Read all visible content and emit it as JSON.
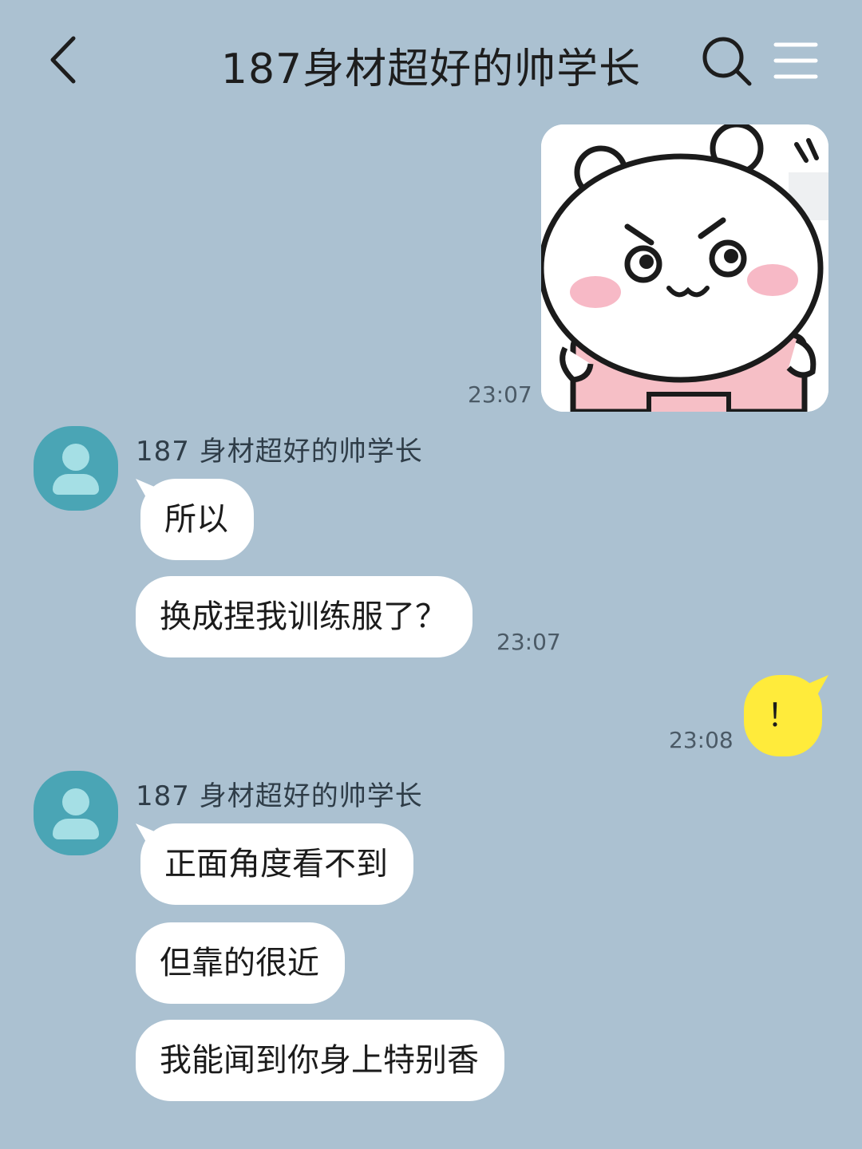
{
  "header": {
    "title": "187身材超好的帅学长",
    "back_icon": "chevron-left-icon",
    "search_icon": "search-icon",
    "menu_icon": "hamburger-menu-icon"
  },
  "messages": [
    {
      "type": "sticker",
      "from": "me",
      "time": "23:07",
      "sticker": "angry-white-bear-sticker"
    },
    {
      "from": "them",
      "sender": "187 身材超好的帅学长",
      "texts": [
        "所以",
        "换成捏我训练服了？"
      ],
      "time": "23:07"
    },
    {
      "from": "me",
      "text": "！",
      "time": "23:08"
    },
    {
      "from": "them",
      "sender": "187 身材超好的帅学长",
      "texts": [
        "正面角度看不到",
        "但靠的很近",
        "我能闻到你身上特别香"
      ]
    }
  ],
  "colors": {
    "background": "#abc1d1",
    "my_bubble": "#ffeb3b",
    "their_bubble": "#ffffff",
    "avatar": "#4aa5b5"
  }
}
